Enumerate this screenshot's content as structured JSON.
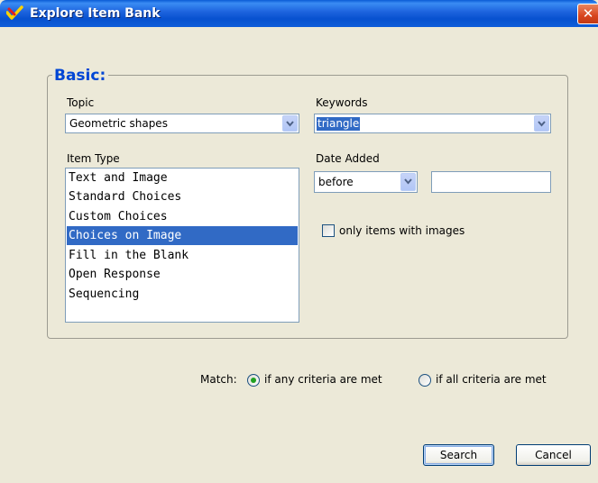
{
  "window": {
    "title": "Explore Item Bank",
    "close_glyph": "✕"
  },
  "group": {
    "title": "Basic:"
  },
  "topic": {
    "label": "Topic",
    "value": "Geometric shapes"
  },
  "keywords": {
    "label": "Keywords",
    "value": "triangle"
  },
  "item_type": {
    "label": "Item Type",
    "items": [
      "Text and Image",
      "Standard Choices",
      "Custom Choices",
      "Choices on Image",
      "Fill in the Blank",
      "Open Response",
      "Sequencing"
    ],
    "selected_index": 3
  },
  "date_added": {
    "label": "Date Added",
    "operator": "before",
    "value": ""
  },
  "images_only": {
    "label": "only items with images",
    "checked": false
  },
  "match": {
    "label": "Match:",
    "options": [
      {
        "label": "if any criteria are met",
        "selected": true
      },
      {
        "label": "if all criteria are met",
        "selected": false
      }
    ]
  },
  "buttons": {
    "search": "Search",
    "cancel": "Cancel"
  },
  "colors": {
    "title_bar": "#0751CF",
    "group_title": "#0046D5",
    "selection": "#316AC5",
    "dialog_bg": "#ECE9D8"
  },
  "icons": {
    "app": "pencil-check-icon",
    "close": "close-icon",
    "dropdown": "chevron-down-icon"
  }
}
